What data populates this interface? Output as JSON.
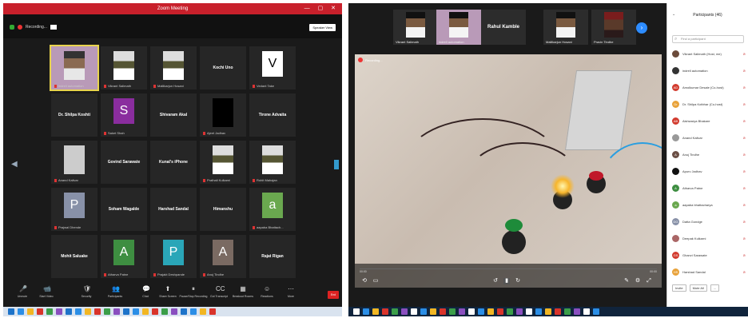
{
  "left": {
    "title": "Zoom Meeting",
    "recording": "Recording...",
    "speaker_view": "Speaker View",
    "tiles": [
      {
        "name": "indrell automation",
        "type": "photo-active"
      },
      {
        "name": "Vikrant Salimath",
        "type": "photo"
      },
      {
        "name": "Mallikarjun Hosani",
        "type": "photo"
      },
      {
        "name": "Kochi Uno",
        "type": "name",
        "caption": ""
      },
      {
        "name": "V",
        "type": "avatar",
        "caption": "Vedant Take",
        "color": "#ffffff",
        "text_color": "#000"
      },
      {
        "name": "Dr. Shilpa Koshti",
        "type": "name",
        "caption": ""
      },
      {
        "name": "S",
        "type": "avatar",
        "caption": "Saket Shah",
        "color": "#8a2d9e"
      },
      {
        "name": "Shivaram Akal",
        "type": "name",
        "caption": ""
      },
      {
        "name": "",
        "type": "black",
        "caption": "Ajeet Jadhav"
      },
      {
        "name": "Tirone Advaita",
        "type": "name",
        "caption": ""
      },
      {
        "name": "",
        "type": "photo-light",
        "caption": "Anand Kalivar"
      },
      {
        "name": "Govind Sarawate",
        "type": "name",
        "caption": ""
      },
      {
        "name": "Kunal's iPhone",
        "type": "name",
        "caption": ""
      },
      {
        "name": "",
        "type": "photo",
        "caption": "Prathali Kulkarni"
      },
      {
        "name": "",
        "type": "photo",
        "caption": "Rohit Mahajan"
      },
      {
        "name": "P",
        "type": "avatar",
        "caption": "Prajwal Dhende",
        "color": "#8891a8"
      },
      {
        "name": "Soham Wagalde",
        "type": "name",
        "caption": ""
      },
      {
        "name": "Harshad Sandal",
        "type": "name",
        "caption": ""
      },
      {
        "name": "Himanshu",
        "type": "name",
        "caption": ""
      },
      {
        "name": "a",
        "type": "avatar",
        "caption": "aapaba Bhattach...",
        "color": "#6aa84f"
      },
      {
        "name": "Mohit Saluake",
        "type": "name",
        "caption": ""
      },
      {
        "name": "A",
        "type": "avatar",
        "caption": "Atharva Patne",
        "color": "#3e8e41"
      },
      {
        "name": "P",
        "type": "avatar",
        "caption": "Prajakt Deshpande",
        "color": "#2aa6b8"
      },
      {
        "name": "A",
        "type": "avatar",
        "caption": "Anuj Tindhe",
        "color": "#7a6a62"
      },
      {
        "name": "Rajat Rigan",
        "type": "name",
        "caption": ""
      }
    ],
    "toolbar": [
      {
        "label": "Unmute",
        "icon": "🎤"
      },
      {
        "label": "Start Video",
        "icon": "📹"
      },
      {
        "label": "Security",
        "icon": "🛡"
      },
      {
        "label": "Participants",
        "icon": "👥"
      },
      {
        "label": "Chat",
        "icon": "💬"
      },
      {
        "label": "Share Screen",
        "icon": "⬆"
      },
      {
        "label": "Pause/Stop Recording",
        "icon": "⏸"
      },
      {
        "label": "Got Transcript",
        "icon": "CC"
      },
      {
        "label": "Breakout Rooms",
        "icon": "▦"
      },
      {
        "label": "Reactions",
        "icon": "☺"
      },
      {
        "label": "More",
        "icon": "⋯"
      }
    ],
    "end_label": "End"
  },
  "right": {
    "strip": [
      {
        "name": "Vikrant Salimath",
        "type": "face"
      },
      {
        "name": "indrell automation",
        "type": "face-purple"
      },
      {
        "name": "Rahul Kamble",
        "type": "name"
      },
      {
        "name": "Mallikarjun Hosani",
        "type": "face"
      },
      {
        "name": "Pravin Tindhe",
        "type": "face-pirate"
      }
    ],
    "recording": "Recording...",
    "time_left": "00:00",
    "time_right": "00:00",
    "participants_title": "Participants (46)",
    "search_placeholder": "Find a participant",
    "participants": [
      {
        "name": "Vikrant Salimath (Host, me)",
        "initials": "",
        "color": "#6b4b3a"
      },
      {
        "name": "indrell automation",
        "initials": "",
        "color": "#333"
      },
      {
        "name": "Amolkumar Desale (Co-host)",
        "initials": "AD",
        "color": "#d23b2e"
      },
      {
        "name": "Dr. Shilpa Kotbhar (Co-host)",
        "initials": "Dr",
        "color": "#e8a23a"
      },
      {
        "name": "Aishwarya Bhakare",
        "initials": "AB",
        "color": "#d23b2e"
      },
      {
        "name": "Anand Kalivar",
        "initials": "",
        "color": "#999"
      },
      {
        "name": "Anuj Tindhe",
        "initials": "A",
        "color": "#6b4f45"
      },
      {
        "name": "Apurv Jadhav",
        "initials": "",
        "color": "#111"
      },
      {
        "name": "Atharva Patne",
        "initials": "A",
        "color": "#3e8e41"
      },
      {
        "name": "aapaba bhattacharya",
        "initials": "a",
        "color": "#6aa84f"
      },
      {
        "name": "Datta Gondge",
        "initials": "DG",
        "color": "#8891a8"
      },
      {
        "name": "Deepak Kulkarni",
        "initials": "",
        "color": "#a66"
      },
      {
        "name": "Ghanvi Sarawate",
        "initials": "GS",
        "color": "#d23b2e"
      },
      {
        "name": "Harshad Sandal",
        "initials": "HS",
        "color": "#e8a23a"
      }
    ],
    "footer": [
      "Invite",
      "Mute All",
      "..."
    ]
  }
}
